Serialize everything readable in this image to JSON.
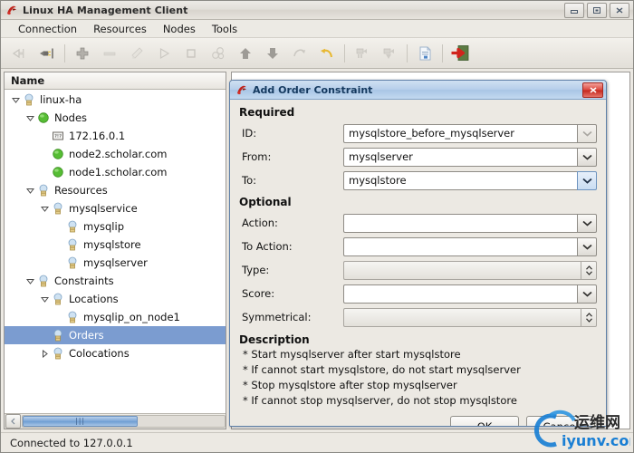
{
  "window": {
    "title": "Linux HA Management Client",
    "icon": "app-icon",
    "controls": {
      "minimize": "minimize-icon",
      "maximize": "maximize-icon",
      "close": "close-icon"
    }
  },
  "menubar": {
    "items": [
      {
        "label": "Connection"
      },
      {
        "label": "Resources"
      },
      {
        "label": "Nodes"
      },
      {
        "label": "Tools"
      }
    ]
  },
  "toolbar": {
    "buttons": [
      {
        "name": "disconnect-icon",
        "enabled": false
      },
      {
        "name": "connect-icon",
        "enabled": true
      },
      {
        "sep": true
      },
      {
        "name": "add-icon",
        "enabled": true
      },
      {
        "name": "remove-icon",
        "enabled": false
      },
      {
        "name": "cleanup-icon",
        "enabled": false
      },
      {
        "name": "start-icon",
        "enabled": false
      },
      {
        "name": "stop-icon",
        "enabled": false
      },
      {
        "name": "manage-icon",
        "enabled": false
      },
      {
        "name": "move-up-icon",
        "enabled": true
      },
      {
        "name": "move-down-icon",
        "enabled": true
      },
      {
        "name": "migrate-icon",
        "enabled": false
      },
      {
        "name": "undo-migrate-icon",
        "enabled": true
      },
      {
        "sep": true
      },
      {
        "name": "standby-icon",
        "enabled": false
      },
      {
        "name": "online-icon",
        "enabled": false
      },
      {
        "sep": true
      },
      {
        "name": "report-icon",
        "enabled": true
      },
      {
        "sep": true
      },
      {
        "name": "exit-icon",
        "enabled": true
      }
    ]
  },
  "tree": {
    "column_header": "Name",
    "rows": [
      {
        "label": "linux-ha",
        "indent": 0,
        "twisty": "open",
        "icon": "cluster-icon"
      },
      {
        "label": "Nodes",
        "indent": 1,
        "twisty": "open",
        "icon": "green-ball-icon"
      },
      {
        "label": "172.16.0.1",
        "indent": 2,
        "twisty": "none",
        "icon": "ip-icon"
      },
      {
        "label": "node2.scholar.com",
        "indent": 2,
        "twisty": "none",
        "icon": "green-ball-icon"
      },
      {
        "label": "node1.scholar.com",
        "indent": 2,
        "twisty": "none",
        "icon": "green-ball-icon"
      },
      {
        "label": "Resources",
        "indent": 1,
        "twisty": "open",
        "icon": "resource-icon"
      },
      {
        "label": "mysqlservice",
        "indent": 2,
        "twisty": "open",
        "icon": "resource-icon"
      },
      {
        "label": "mysqlip",
        "indent": 3,
        "twisty": "none",
        "icon": "resource-icon"
      },
      {
        "label": "mysqlstore",
        "indent": 3,
        "twisty": "none",
        "icon": "resource-icon"
      },
      {
        "label": "mysqlserver",
        "indent": 3,
        "twisty": "none",
        "icon": "resource-icon"
      },
      {
        "label": "Constraints",
        "indent": 1,
        "twisty": "open",
        "icon": "resource-icon"
      },
      {
        "label": "Locations",
        "indent": 2,
        "twisty": "open",
        "icon": "resource-icon"
      },
      {
        "label": "mysqlip_on_node1",
        "indent": 3,
        "twisty": "none",
        "icon": "resource-icon"
      },
      {
        "label": "Orders",
        "indent": 2,
        "twisty": "none",
        "icon": "resource-icon",
        "selected": true
      },
      {
        "label": "Colocations",
        "indent": 2,
        "twisty": "closed",
        "icon": "resource-icon"
      }
    ]
  },
  "statusbar": {
    "text": "Connected to 127.0.0.1"
  },
  "dialog": {
    "title": "Add Order Constraint",
    "icon": "app-icon",
    "close_label": "close-icon",
    "sections": {
      "required_header": "Required",
      "optional_header": "Optional",
      "description_header": "Description"
    },
    "fields": [
      {
        "label": "ID:",
        "value": "mysqlstore_before_mysqlserver",
        "control": "combo-flat",
        "arrow": "chevron-down-icon",
        "state": "dim",
        "name": "id-field"
      },
      {
        "label": "From:",
        "value": "mysqlserver",
        "control": "combo-flat",
        "arrow": "chevron-down-icon",
        "state": "normal",
        "name": "from-field"
      },
      {
        "label": "To:",
        "value": "mysqlstore",
        "control": "combo-flat",
        "arrow": "chevron-down-icon",
        "state": "focus",
        "name": "to-field"
      },
      {
        "label": "Action:",
        "value": "",
        "control": "combo-flat",
        "arrow": "chevron-down-icon",
        "state": "normal",
        "name": "action-field"
      },
      {
        "label": "To Action:",
        "value": "",
        "control": "combo-flat",
        "arrow": "chevron-down-icon",
        "state": "normal",
        "name": "to-action-field"
      },
      {
        "label": "Type:",
        "value": "",
        "control": "spinner",
        "arrow": "up-down-arrows-icon",
        "state": "normal",
        "name": "type-field"
      },
      {
        "label": "Score:",
        "value": "",
        "control": "combo-flat",
        "arrow": "chevron-down-icon",
        "state": "normal",
        "name": "score-field"
      },
      {
        "label": "Symmetrical:",
        "value": "",
        "control": "spinner",
        "arrow": "up-down-arrows-icon",
        "state": "normal",
        "name": "symmetrical-field"
      }
    ],
    "description_lines": [
      "* Start mysqlserver after start mysqlstore",
      "* If cannot start mysqlstore, do not start mysqlserver",
      "* Stop mysqlstore after stop mysqlserver",
      "* If cannot stop mysqlserver, do not stop mysqlstore"
    ],
    "buttons": {
      "ok": "OK",
      "cancel": "Cancel"
    }
  },
  "watermark": {
    "cn": "运维网",
    "url": "iyunv.com"
  },
  "colors": {
    "window_bg": "#ece9e3",
    "dialog_title": "#b7cfea",
    "selection": "#7b9cd0",
    "accent_red": "#d9453b",
    "node_green": "#5fbf3f",
    "watermark_blue": "#1a7fd4"
  }
}
